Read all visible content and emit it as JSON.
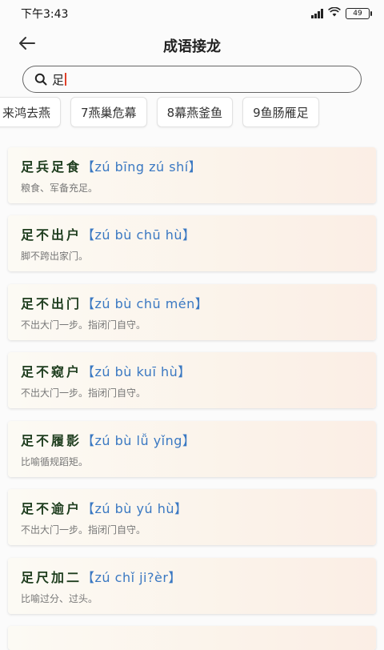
{
  "status_bar": {
    "time": "下午3:43",
    "battery": "49"
  },
  "header": {
    "title": "成语接龙",
    "back_icon": "arrow-left-icon"
  },
  "search": {
    "value": "足",
    "icon": "search-icon"
  },
  "chips": [
    {
      "label": "来鸿去燕"
    },
    {
      "label": "7燕巢危幕"
    },
    {
      "label": "8幕燕釜鱼"
    },
    {
      "label": "9鱼肠雁足"
    }
  ],
  "idioms": [
    {
      "word": "足兵足食",
      "pinyin": "【zú bīng zú shí】",
      "meaning": "粮食、军备充足。"
    },
    {
      "word": "足不出户",
      "pinyin": "【zú bù chū hù】",
      "meaning": "脚不跨出家门。"
    },
    {
      "word": "足不出门",
      "pinyin": "【zú bù chū mén】",
      "meaning": "不出大门一步。指闭门自守。"
    },
    {
      "word": "足不窥户",
      "pinyin": "【zú bù kuī hù】",
      "meaning": "不出大门一步。指闭门自守。"
    },
    {
      "word": "足不履影",
      "pinyin": "【zú bù lǚ yǐng】",
      "meaning": "比喻循规蹈矩。"
    },
    {
      "word": "足不逾户",
      "pinyin": "【zú bù yú hù】",
      "meaning": "不出大门一步。指闭门自守。"
    },
    {
      "word": "足尺加二",
      "pinyin": "【zú chǐ ji?èr】",
      "meaning": "比喻过分、过头。"
    }
  ]
}
